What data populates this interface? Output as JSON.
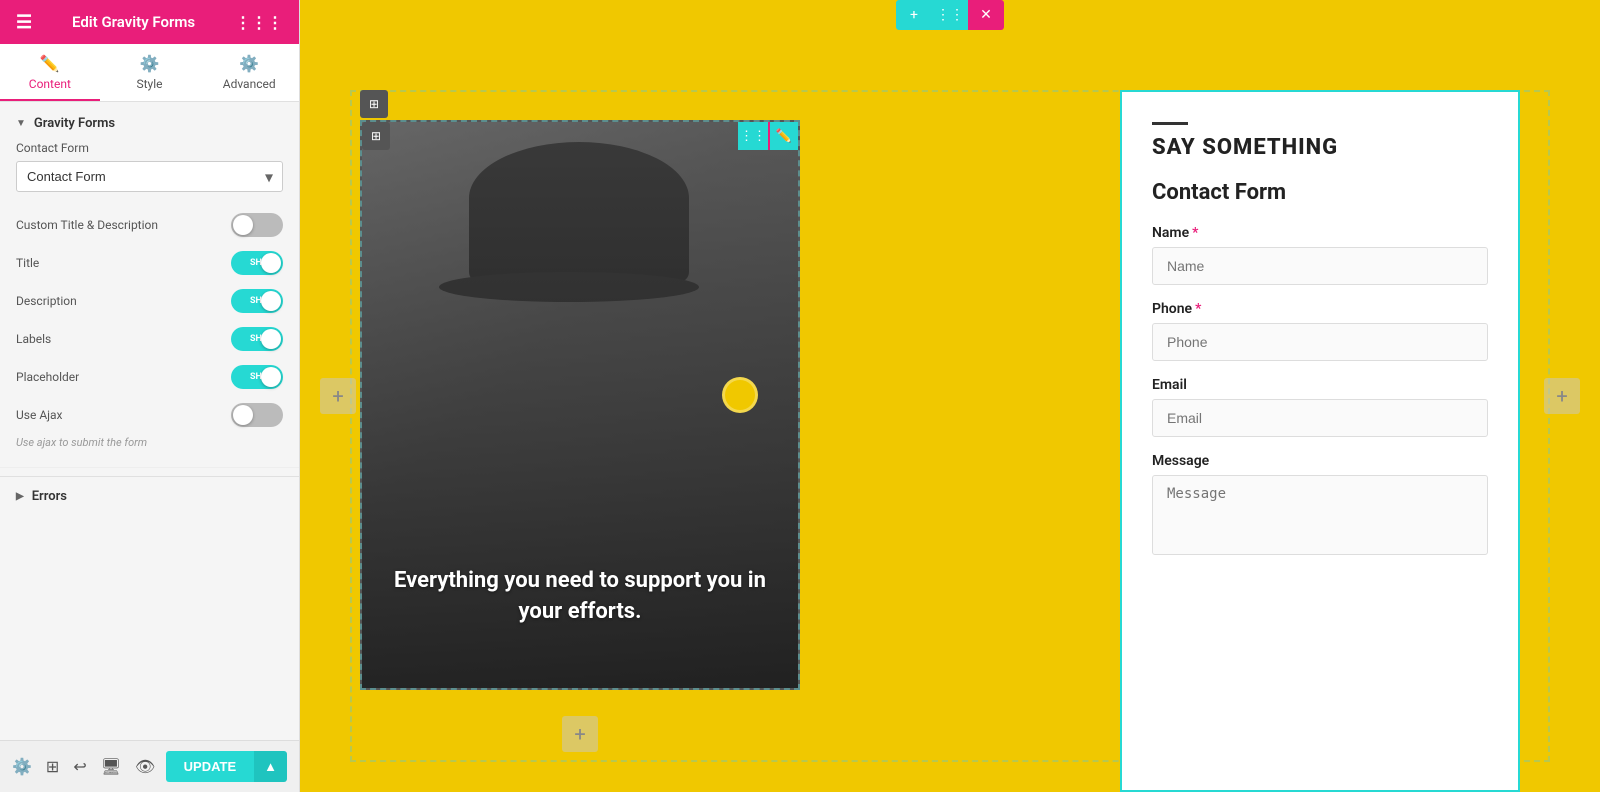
{
  "header": {
    "title": "Edit Gravity Forms",
    "hamburger_icon": "☰",
    "grid_icon": "⋮⋮⋮"
  },
  "tabs": [
    {
      "id": "content",
      "label": "Content",
      "icon": "✏️",
      "active": true
    },
    {
      "id": "style",
      "label": "Style",
      "icon": "⚙️",
      "active": false
    },
    {
      "id": "advanced",
      "label": "Advanced",
      "icon": "⚙️",
      "active": false
    }
  ],
  "panel": {
    "section_title": "Gravity Forms",
    "contact_form_label": "Contact Form",
    "contact_form_value": "Contact Form",
    "custom_title_label": "Custom Title & Description",
    "title_label": "Title",
    "description_label": "Description",
    "labels_label": "Labels",
    "placeholder_label": "Placeholder",
    "use_ajax_label": "Use Ajax",
    "ajax_note": "Use ajax to submit the form",
    "errors_label": "Errors"
  },
  "footer": {
    "update_label": "UPDATE"
  },
  "main": {
    "overlay_text": "Everything you need to support you in your efforts.",
    "say_something": "SAY SOMETHING",
    "form_title": "Contact Form",
    "fields": [
      {
        "label": "Name",
        "placeholder": "Name",
        "required": true,
        "type": "text"
      },
      {
        "label": "Phone",
        "placeholder": "Phone",
        "required": true,
        "type": "text"
      },
      {
        "label": "Email",
        "placeholder": "Email",
        "required": false,
        "type": "text"
      },
      {
        "label": "Message",
        "placeholder": "Message",
        "required": false,
        "type": "textarea"
      }
    ]
  },
  "colors": {
    "pink": "#e91e7a",
    "teal": "#26d9d3",
    "yellow": "#f0c800",
    "dark": "#222222"
  }
}
